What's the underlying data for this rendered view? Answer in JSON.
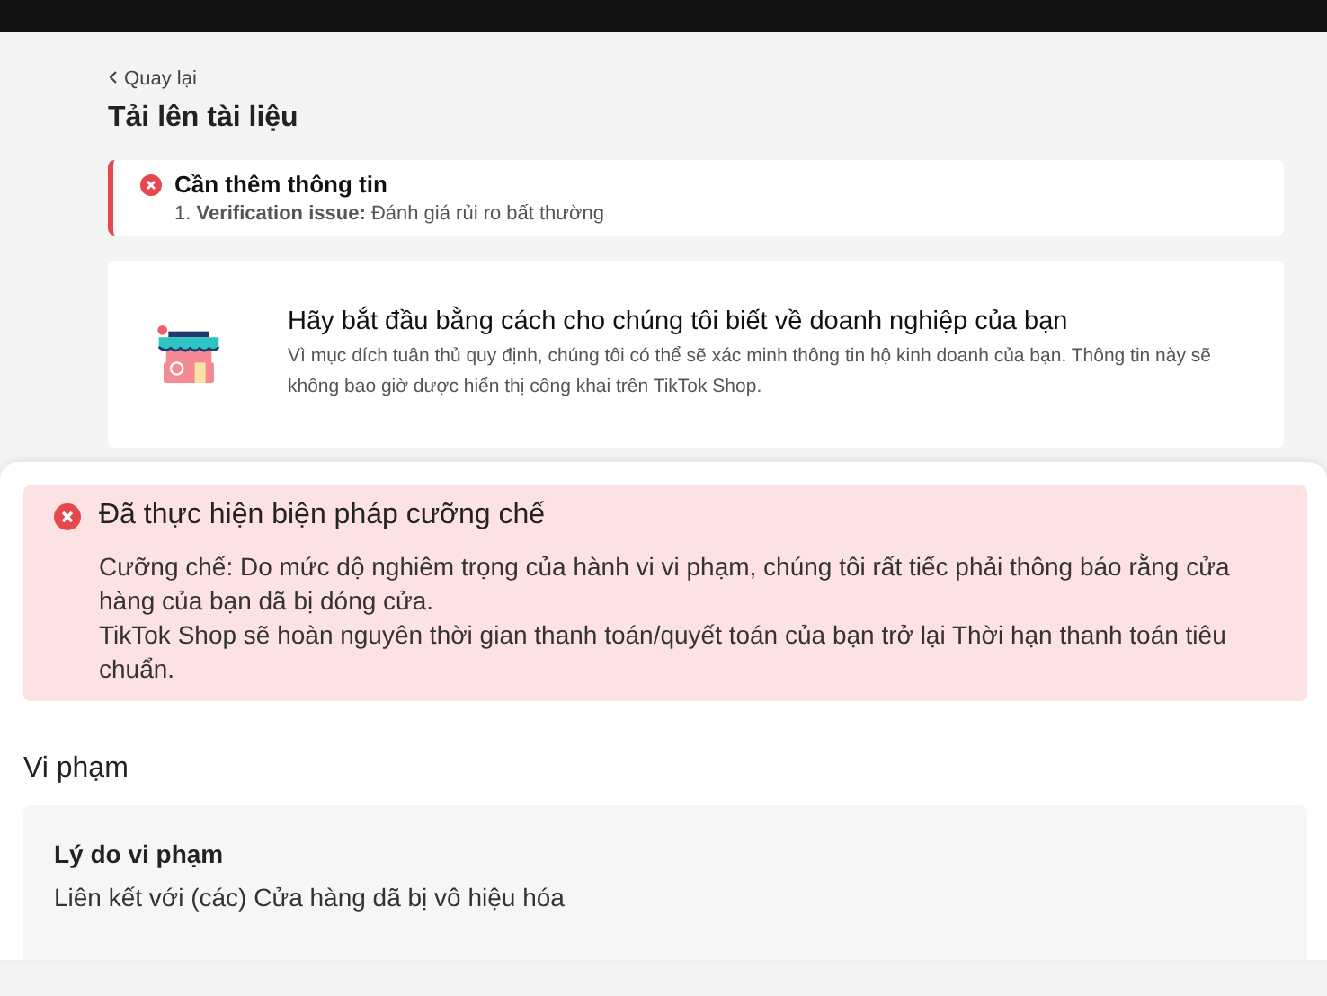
{
  "back_link": "Quay lại",
  "page_title": "Tải lên tài liệu",
  "info_needed": {
    "title": "Cần thêm thông tin",
    "items": [
      {
        "number": "1.",
        "label": "Verification issue:",
        "text": "Đánh giá rủi ro bất thường"
      }
    ]
  },
  "business_card": {
    "title": "Hãy bắt đầu bằng cách cho chúng tôi biết về doanh nghiệp của bạn",
    "description": "Vì mục dích tuân thủ quy định, chúng tôi có thể sẽ xác minh thông tin hộ kinh doanh của bạn. Thông tin này sẽ không bao giờ dược hiển thị công khai trên TikTok Shop."
  },
  "enforcement": {
    "title": "Đã thực hiện biện pháp cưỡng chế",
    "lines": [
      "Cưỡng chế: Do mức dộ nghiêm trọng của hành vi vi phạm, chúng tôi rất tiếc phải thông báo rằng cửa hàng của bạn dã bị dóng cửa.",
      "TikTok Shop sẽ hoàn nguyên thời gian thanh toán/quyết toán của bạn trở lại Thời hạn thanh toán tiêu chuẩn."
    ]
  },
  "violation": {
    "heading": "Vi phạm",
    "fields": [
      {
        "label": "Lý do vi phạm",
        "value": "Liên kết với (các) Cửa hàng dã bị vô hiệu hóa"
      }
    ]
  }
}
